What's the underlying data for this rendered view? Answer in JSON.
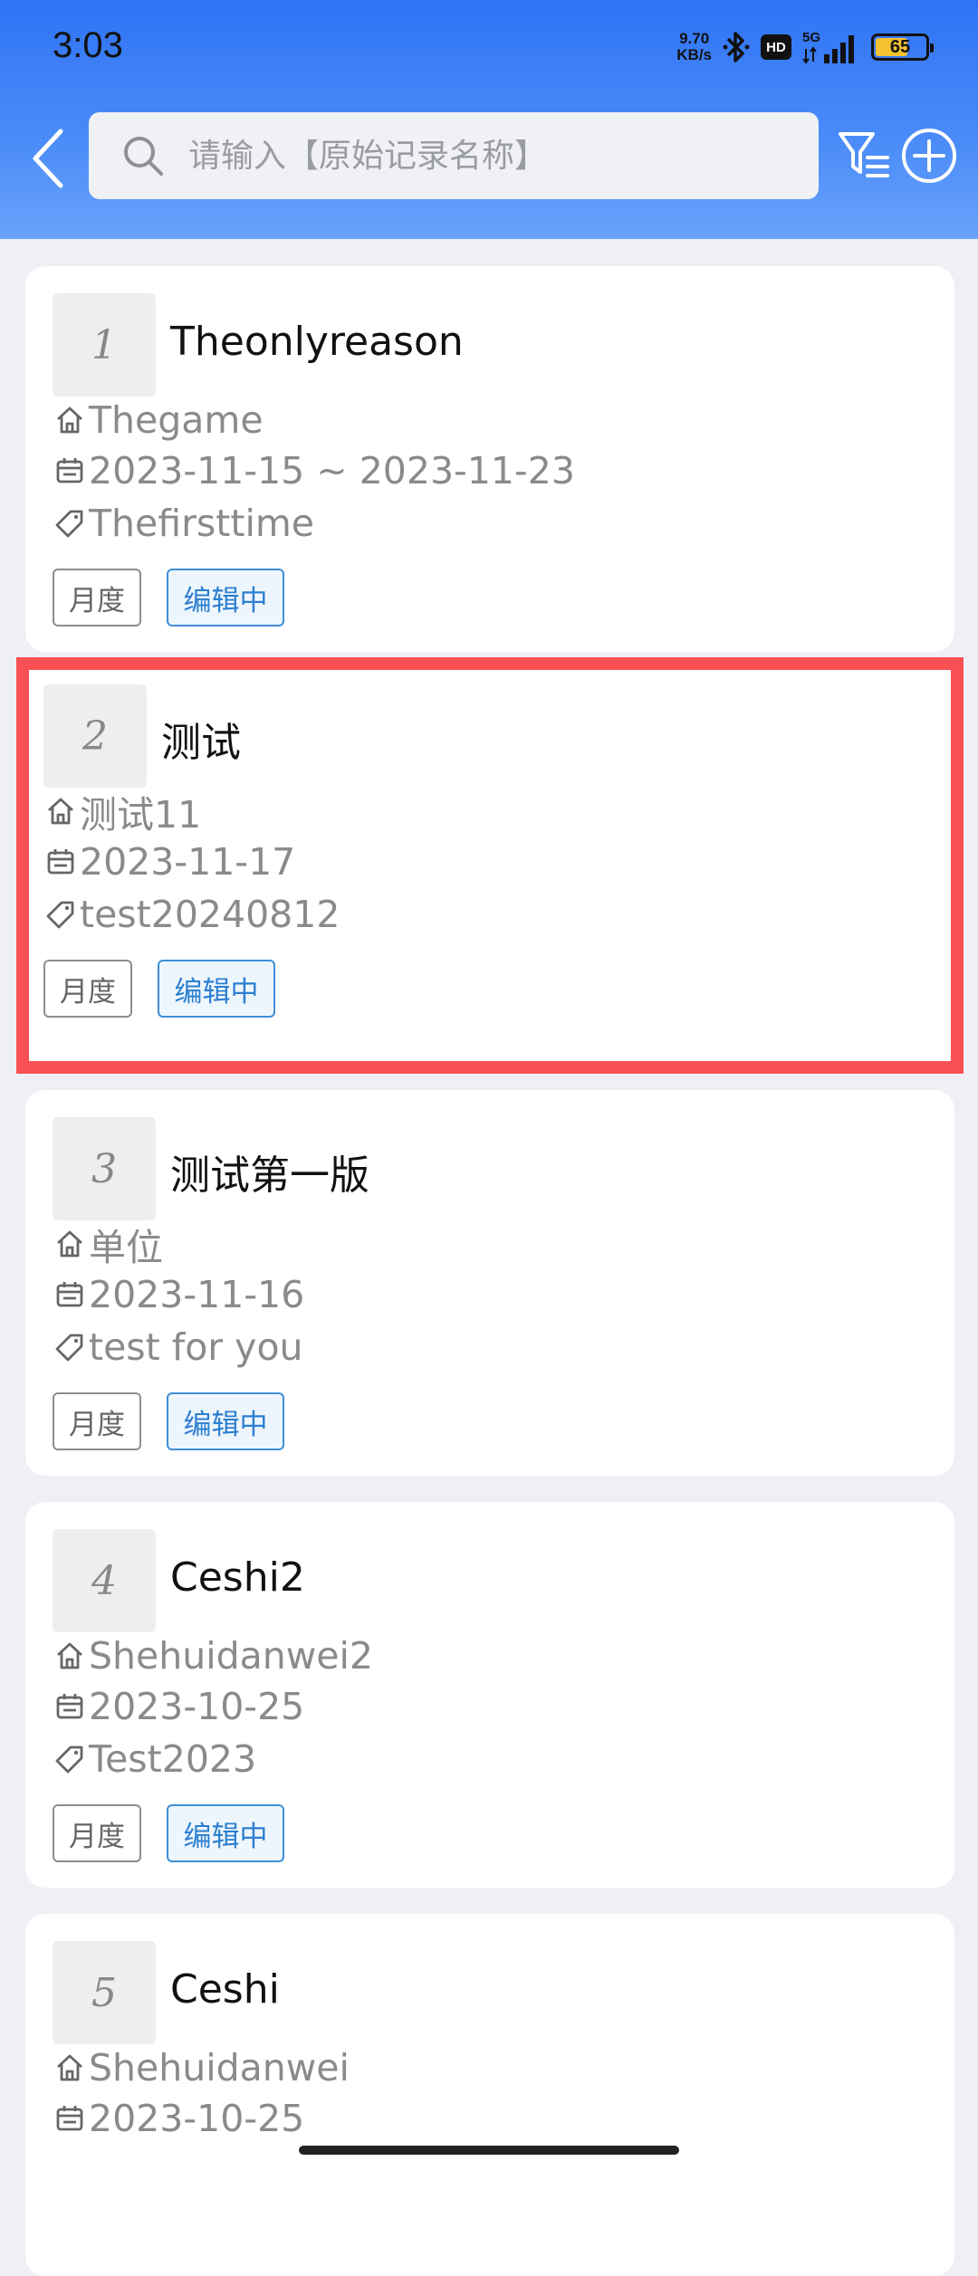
{
  "status_bar": {
    "time": "3:03",
    "net_speed_value": "9.70",
    "net_speed_unit": "KB/s",
    "hd": "HD",
    "network": "5G",
    "battery": "65"
  },
  "header": {
    "search_placeholder": "请输入【原始记录名称】",
    "search_value": ""
  },
  "records": [
    {
      "index": "1",
      "title": "Theonlyreason",
      "unit": "Thegame",
      "date": "2023-11-15 ~ 2023-11-23",
      "tag": "Thefirsttime",
      "period": "月度",
      "status": "编辑中"
    },
    {
      "index": "2",
      "title": "测试",
      "unit": "测试11",
      "date": "2023-11-17",
      "tag": "test20240812",
      "period": "月度",
      "status": "编辑中"
    },
    {
      "index": "3",
      "title": "测试第一版",
      "unit": "单位",
      "date": "2023-11-16",
      "tag": "test for you",
      "period": "月度",
      "status": "编辑中"
    },
    {
      "index": "4",
      "title": "Ceshi2",
      "unit": "Shehuidanwei2",
      "date": "2023-10-25",
      "tag": "Test2023",
      "period": "月度",
      "status": "编辑中"
    },
    {
      "index": "5",
      "title": "Ceshi",
      "unit": "Shehuidanwei",
      "date": "2023-10-25"
    }
  ],
  "colors": {
    "header_gradient_top": "#2f73f5",
    "highlight_border": "#fb5053",
    "status_editing": "#2c7fd1"
  }
}
